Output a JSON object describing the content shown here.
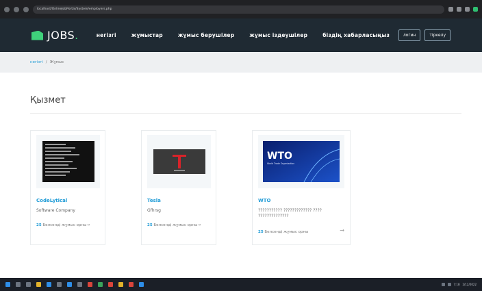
{
  "browser": {
    "url": "localhost/OnlineJobPortal/System/employers.php"
  },
  "nav": {
    "logo_text": "JOBS",
    "logo_dot": ".",
    "menu": [
      "негізгі",
      "жұмыстар",
      "жұмыс берушілер",
      "жұмыс іздеушілер",
      "біздің хабарласыңыз"
    ],
    "login": "логин",
    "register": "тіркелу"
  },
  "breadcrumb": {
    "home": "негізгі",
    "sep": "/",
    "current": "Жұмыс"
  },
  "page": {
    "title": "Қызмет"
  },
  "cards": [
    {
      "name": "CodeLytical",
      "category": "Software Company",
      "jobs_count": "25",
      "jobs_text": "Белсенді жұмыс орны"
    },
    {
      "name": "Tesla",
      "category": "Gfhrsg",
      "jobs_count": "25",
      "jobs_text": "Белсенді жұмыс орны"
    },
    {
      "name": "WTO",
      "category": "??????????? ????????????? ???? ??????????????",
      "jobs_count": "25",
      "jobs_text": "Белсенді жұмыс орны"
    }
  ],
  "images": {
    "wto_logo": "WTO",
    "wto_sub": "World Trade Organization"
  },
  "arrow": "→",
  "tray": {
    "time": "7:18",
    "date": "2/12/2022"
  }
}
